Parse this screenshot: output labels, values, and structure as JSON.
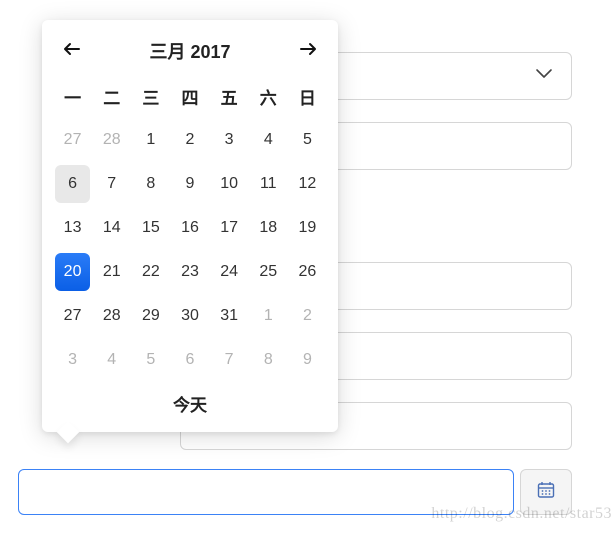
{
  "calendar": {
    "title": "三月 2017",
    "dow": [
      "一",
      "二",
      "三",
      "四",
      "五",
      "六",
      "日"
    ],
    "days": [
      {
        "n": "27",
        "out": true
      },
      {
        "n": "28",
        "out": true
      },
      {
        "n": "1"
      },
      {
        "n": "2"
      },
      {
        "n": "3"
      },
      {
        "n": "4"
      },
      {
        "n": "5"
      },
      {
        "n": "6",
        "today": true
      },
      {
        "n": "7"
      },
      {
        "n": "8"
      },
      {
        "n": "9"
      },
      {
        "n": "10"
      },
      {
        "n": "11"
      },
      {
        "n": "12"
      },
      {
        "n": "13"
      },
      {
        "n": "14"
      },
      {
        "n": "15"
      },
      {
        "n": "16"
      },
      {
        "n": "17"
      },
      {
        "n": "18"
      },
      {
        "n": "19"
      },
      {
        "n": "20",
        "selected": true
      },
      {
        "n": "21"
      },
      {
        "n": "22"
      },
      {
        "n": "23"
      },
      {
        "n": "24"
      },
      {
        "n": "25"
      },
      {
        "n": "26"
      },
      {
        "n": "27"
      },
      {
        "n": "28"
      },
      {
        "n": "29"
      },
      {
        "n": "30"
      },
      {
        "n": "31"
      },
      {
        "n": "1",
        "out": true
      },
      {
        "n": "2",
        "out": true
      },
      {
        "n": "3",
        "out": true
      },
      {
        "n": "4",
        "out": true
      },
      {
        "n": "5",
        "out": true
      },
      {
        "n": "6",
        "out": true
      },
      {
        "n": "7",
        "out": true
      },
      {
        "n": "8",
        "out": true
      },
      {
        "n": "9",
        "out": true
      }
    ],
    "today_label": "今天"
  },
  "watermark": "http://blog.csdn.net/star53"
}
